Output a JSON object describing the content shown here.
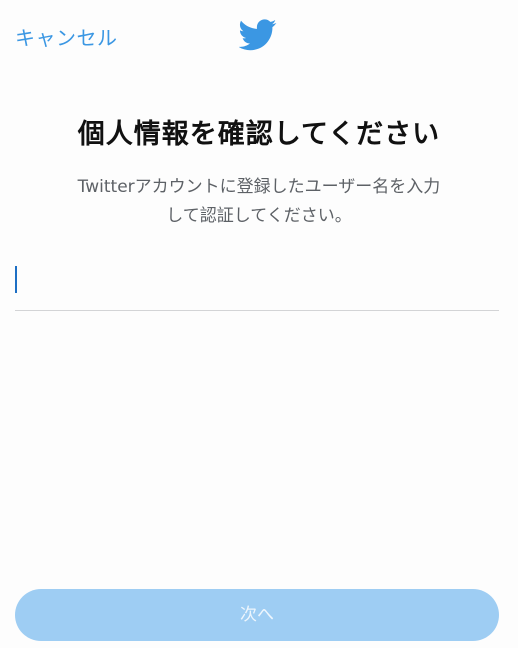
{
  "header": {
    "cancel_label": "キャンセル",
    "logo_icon": "twitter-bird-icon"
  },
  "main": {
    "title": "個人情報を確認してください",
    "subtitle_line1": "Twitterアカウントに登録したユーザー名を入力",
    "subtitle_line2": "して認証してください。",
    "username_field": {
      "value": "",
      "placeholder": ""
    }
  },
  "footer": {
    "next_label": "次へ"
  },
  "colors": {
    "accent": "#3b97e3",
    "button_disabled": "#9ecdf3",
    "caret": "#1d6fc4"
  }
}
